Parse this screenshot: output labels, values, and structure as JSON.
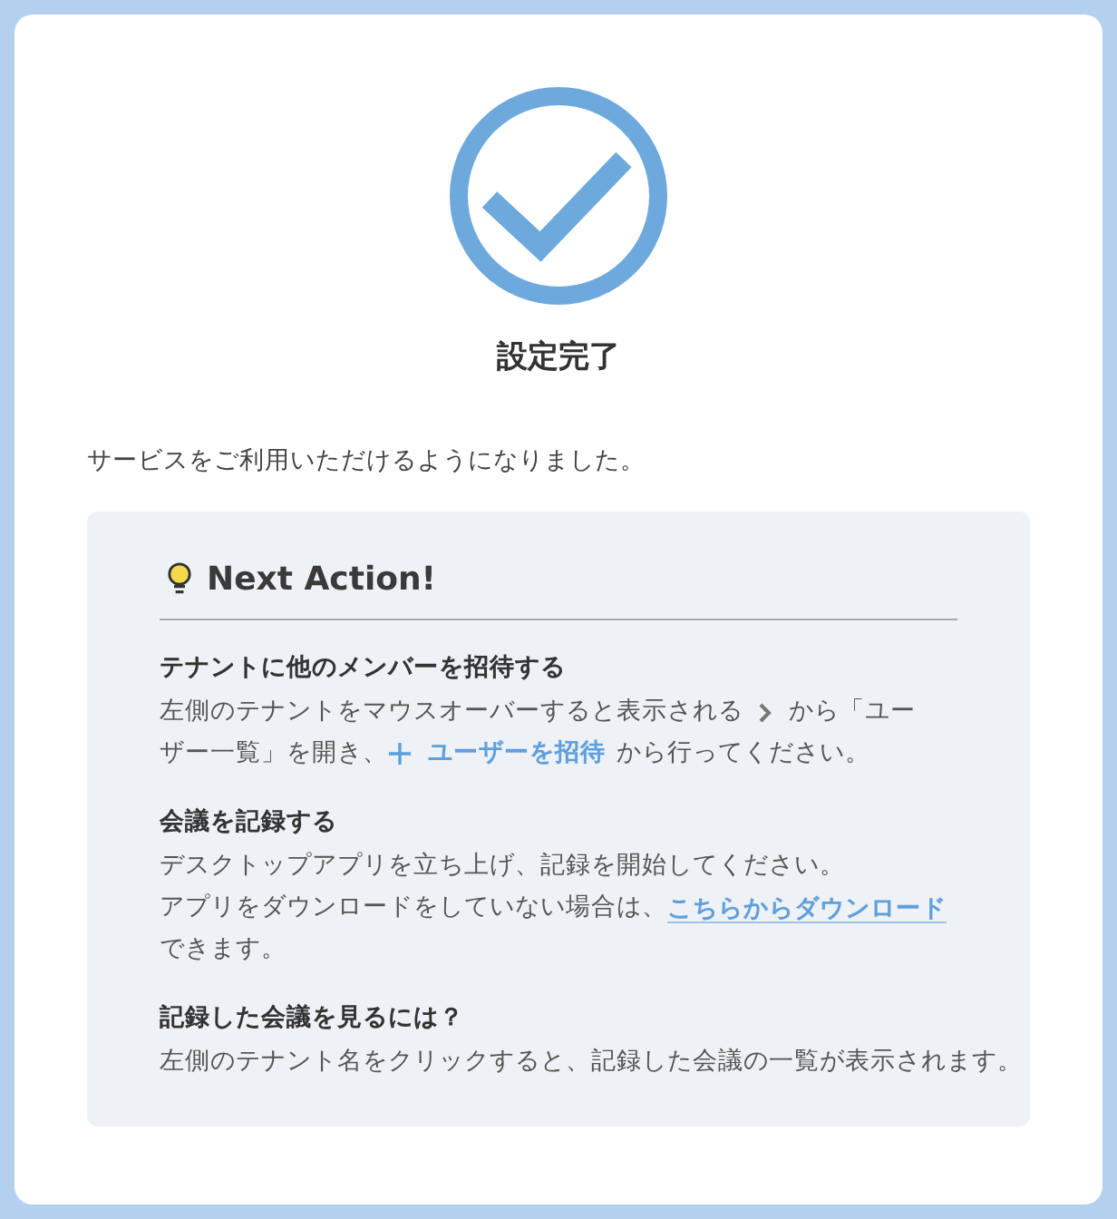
{
  "card": {
    "title": "設定完了",
    "message": "サービスをご利用いただけるようになりました。"
  },
  "next_action": {
    "heading": "Next Action!",
    "sections": [
      {
        "title": "テナントに他のメンバーを招待する",
        "lines": [
          [
            {
              "kind": "text",
              "text": "左側のテナントをマウスオーバーすると表示される"
            },
            {
              "kind": "icon"
            },
            {
              "kind": "text",
              "text": "から「ユー"
            }
          ],
          [
            {
              "kind": "text",
              "text": "ザー一覧」を開き、"
            },
            {
              "kind": "action",
              "text": "ユーザーを招待"
            },
            {
              "kind": "text",
              "text": "から行ってください。"
            }
          ]
        ]
      },
      {
        "title": "会議を記録する",
        "lines": [
          [
            {
              "kind": "text",
              "text": "デスクトップアプリを立ち上げ、記録を開始してください。"
            }
          ],
          [
            {
              "kind": "text",
              "text": "アプリをダウンロードをしていない場合は、"
            },
            {
              "kind": "link",
              "text": "こちらからダウンロード"
            }
          ],
          [
            {
              "kind": "text",
              "text": "できます。"
            }
          ]
        ]
      },
      {
        "title": "記録した会議を見るには？",
        "lines": [
          [
            {
              "kind": "text",
              "text": "左側のテナント名をクリックすると、記録した会議の一覧が表示されます。"
            }
          ]
        ]
      }
    ]
  }
}
